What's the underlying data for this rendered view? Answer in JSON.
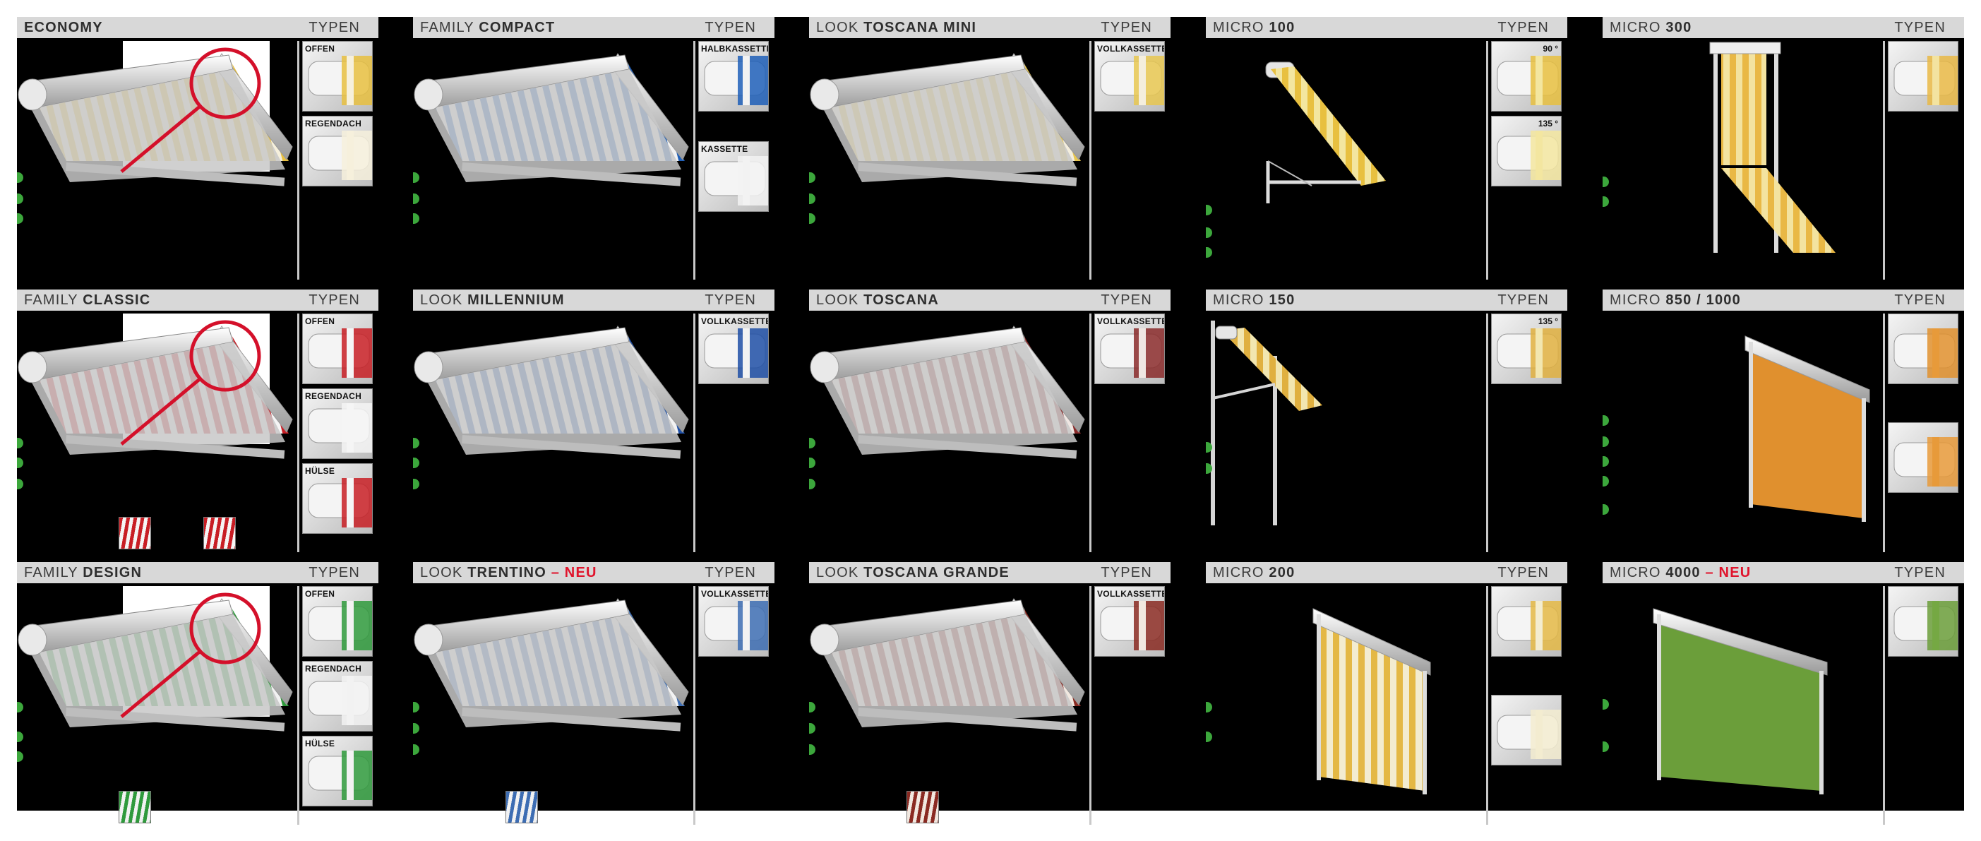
{
  "panels": [
    {
      "prefix": "",
      "name": "ECONOMY",
      "suffix": "",
      "typen": "TYPEN",
      "thumbs": [
        {
          "label": "OFFEN",
          "angle": ""
        },
        {
          "label": "REGENDACH",
          "angle": ""
        }
      ]
    },
    {
      "prefix": "FAMILY ",
      "name": "COMPACT",
      "suffix": "",
      "typen": "TYPEN",
      "thumbs": [
        {
          "label": "HALBKASSETTE",
          "angle": ""
        },
        {
          "label": "KASSETTE",
          "angle": ""
        }
      ]
    },
    {
      "prefix": "LOOK ",
      "name": "TOSCANA MINI",
      "suffix": "",
      "typen": "TYPEN",
      "thumbs": [
        {
          "label": "VOLLKASSETTE",
          "angle": ""
        }
      ]
    },
    {
      "prefix": "MICRO ",
      "name": "100",
      "suffix": "",
      "typen": "TYPEN",
      "thumbs": [
        {
          "label": "",
          "angle": "90 °"
        },
        {
          "label": "",
          "angle": "135 °"
        }
      ]
    },
    {
      "prefix": "MICRO ",
      "name": "300",
      "suffix": "",
      "typen": "TYPEN",
      "thumbs": [
        {
          "label": "",
          "angle": ""
        }
      ]
    },
    {
      "prefix": "FAMILY ",
      "name": "CLASSIC",
      "suffix": "",
      "typen": "TYPEN",
      "thumbs": [
        {
          "label": "OFFEN",
          "angle": ""
        },
        {
          "label": "REGENDACH",
          "angle": ""
        },
        {
          "label": "HÜLSE",
          "angle": ""
        }
      ]
    },
    {
      "prefix": "LOOK ",
      "name": "MILLENNIUM",
      "suffix": "",
      "typen": "TYPEN",
      "thumbs": [
        {
          "label": "VOLLKASSETTE",
          "angle": ""
        }
      ]
    },
    {
      "prefix": "LOOK ",
      "name": "TOSCANA",
      "suffix": "",
      "typen": "TYPEN",
      "thumbs": [
        {
          "label": "VOLLKASSETTE",
          "angle": ""
        }
      ]
    },
    {
      "prefix": "MICRO ",
      "name": "150",
      "suffix": "",
      "typen": "TYPEN",
      "thumbs": [
        {
          "label": "",
          "angle": "135 °"
        }
      ]
    },
    {
      "prefix": "MICRO ",
      "name": "850 / 1000",
      "suffix": "",
      "typen": "TYPEN",
      "thumbs": [
        {
          "label": "",
          "angle": ""
        },
        {
          "label": "",
          "angle": ""
        }
      ]
    },
    {
      "prefix": "FAMILY ",
      "name": "DESIGN",
      "suffix": "",
      "typen": "TYPEN",
      "thumbs": [
        {
          "label": "OFFEN",
          "angle": ""
        },
        {
          "label": "REGENDACH",
          "angle": ""
        },
        {
          "label": "HÜLSE",
          "angle": ""
        }
      ]
    },
    {
      "prefix": "LOOK ",
      "name": "TRENTINO",
      "suffix": " – NEU",
      "typen": "TYPEN",
      "thumbs": [
        {
          "label": "VOLLKASSETTE",
          "angle": ""
        }
      ]
    },
    {
      "prefix": "LOOK ",
      "name": "TOSCANA GRANDE",
      "suffix": "",
      "typen": "TYPEN",
      "thumbs": [
        {
          "label": "VOLLKASSETTE",
          "angle": ""
        }
      ]
    },
    {
      "prefix": "MICRO ",
      "name": "200",
      "suffix": "",
      "typen": "TYPEN",
      "thumbs": [
        {
          "label": "",
          "angle": ""
        },
        {
          "label": "",
          "angle": ""
        }
      ]
    },
    {
      "prefix": "MICRO ",
      "name": "4000",
      "suffix": " – NEU",
      "typen": "TYPEN",
      "thumbs": [
        {
          "label": "",
          "angle": ""
        }
      ]
    }
  ],
  "colors": {
    "accent_red": "#e0142c",
    "dot_green": "#3ca73c",
    "header_bg": "#d8d8d8",
    "sheet_bg": "#000000"
  }
}
